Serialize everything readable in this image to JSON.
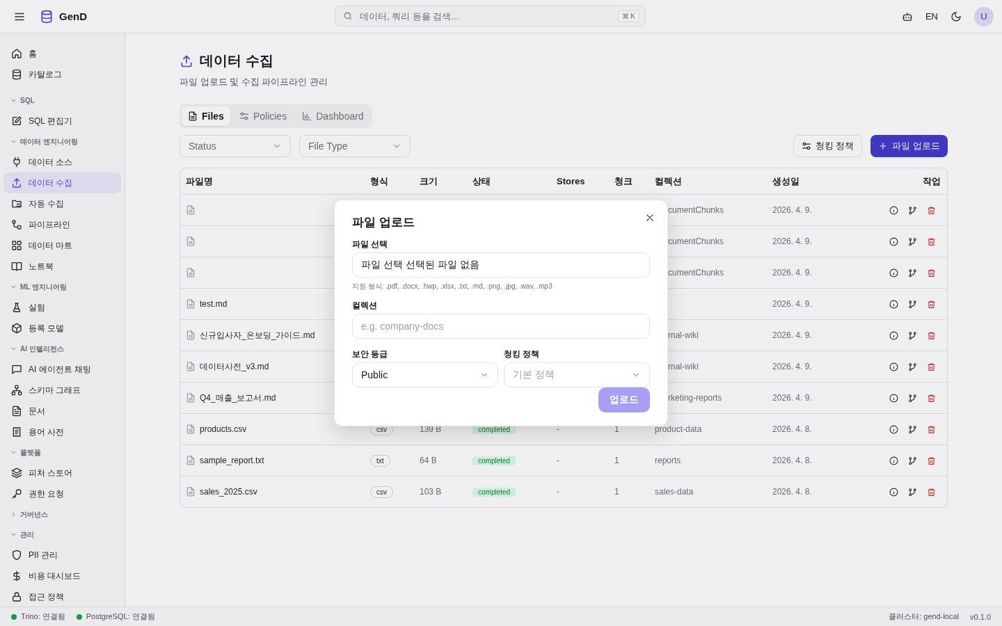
{
  "topbar": {
    "brand": "GenD",
    "search_placeholder": "데이터, 쿼리 등을 검색...",
    "shortcut": "⌘ K",
    "language": "EN",
    "avatar": "U"
  },
  "sidebar": {
    "sections": [
      {
        "items": [
          {
            "label": "홈",
            "kind": "home",
            "selected": false
          },
          {
            "label": "카탈로그",
            "kind": "database",
            "selected": false
          }
        ]
      },
      {
        "title": "SQL",
        "expanded": true,
        "items": [
          {
            "label": "SQL 편집기",
            "kind": "pencil",
            "selected": false
          }
        ]
      },
      {
        "title": "데이터 엔지니어링",
        "expanded": true,
        "items": [
          {
            "label": "데이터 소스",
            "kind": "plug",
            "selected": false
          },
          {
            "label": "데이터 수집",
            "kind": "upload",
            "selected": true
          },
          {
            "label": "자동 수집",
            "kind": "folder",
            "selected": false
          },
          {
            "label": "파이프라인",
            "kind": "nodes",
            "selected": false
          },
          {
            "label": "데이터 마트",
            "kind": "grid",
            "selected": false
          },
          {
            "label": "노트북",
            "kind": "book",
            "selected": false
          }
        ]
      },
      {
        "title": "ML 엔지니어링",
        "expanded": true,
        "items": [
          {
            "label": "실험",
            "kind": "flask",
            "selected": false
          },
          {
            "label": "등록 모델",
            "kind": "cube",
            "selected": false
          }
        ]
      },
      {
        "title": "AI 인텔리전스",
        "expanded": true,
        "items": [
          {
            "label": "AI 에이전트 채팅",
            "kind": "chat",
            "selected": false
          },
          {
            "label": "스키마 그래프",
            "kind": "hierarchy",
            "selected": false
          },
          {
            "label": "문서",
            "kind": "document",
            "selected": false
          },
          {
            "label": "용어 사전",
            "kind": "notebook",
            "selected": false
          }
        ]
      },
      {
        "title": "플랫폼",
        "expanded": true,
        "items": [
          {
            "label": "피처 스토어",
            "kind": "layers",
            "selected": false
          },
          {
            "label": "권한 요청",
            "kind": "key",
            "selected": false
          }
        ]
      },
      {
        "title": "거버넌스",
        "expanded": false
      },
      {
        "title": "관리",
        "expanded": true,
        "items": [
          {
            "label": "PII 관리",
            "kind": "shield",
            "selected": false
          },
          {
            "label": "비용 대시보드",
            "kind": "dollar",
            "selected": false
          },
          {
            "label": "접근 정책",
            "kind": "lock",
            "selected": false
          }
        ]
      }
    ]
  },
  "page": {
    "title": "데이터 수집",
    "subtitle": "파일 업로드 및 수집 파이프라인 관리",
    "tabs": [
      {
        "label": "Files",
        "kind": "file",
        "selected": true
      },
      {
        "label": "Policies",
        "kind": "sliders",
        "selected": false
      },
      {
        "label": "Dashboard",
        "kind": "chart",
        "selected": false
      }
    ],
    "filters": [
      {
        "placeholder": "Status"
      },
      {
        "placeholder": "File Type"
      }
    ],
    "buttons": [
      {
        "label": "청킹 정책",
        "kind": "secondary"
      },
      {
        "label": "파일 업로드",
        "kind": "primary"
      }
    ]
  },
  "table": {
    "columns": [
      "파일명",
      "형식",
      "크기",
      "상태",
      "Stores",
      "청크",
      "컬렉션",
      "생성일",
      "작업"
    ],
    "rows": [
      {
        "collection": "cumentChunks",
        "clipped": true,
        "created": "2026. 4. 9."
      },
      {
        "collection": "cumentChunks",
        "clipped": true,
        "created": "2026. 4. 9."
      },
      {
        "collection": "cumentChunks",
        "clipped": true,
        "created": "2026. 4. 9."
      },
      {
        "name": "test.md",
        "created": "2026. 4. 9."
      },
      {
        "name": "신규입사자_온보딩_가이드.md",
        "collection": "rnal-wiki",
        "clipped": true,
        "created": "2026. 4. 9."
      },
      {
        "name": "데이터사전_v3.md",
        "collection": "rnal-wiki",
        "clipped": true,
        "created": "2026. 4. 9."
      },
      {
        "name": "Q4_매출_보고서.md",
        "collection": "rketing-reports",
        "clipped": true,
        "created": "2026. 4. 9."
      },
      {
        "name": "products.csv",
        "format": "csv",
        "size": "139 B",
        "status": "completed",
        "stores": "-",
        "chunks": "1",
        "collection": "product-data",
        "clipped": false,
        "created": "2026. 4. 8."
      },
      {
        "name": "sample_report.txt",
        "format": "txt",
        "size": "64 B",
        "status": "completed",
        "stores": "-",
        "chunks": "1",
        "collection": "reports",
        "clipped": false,
        "created": "2026. 4. 8."
      },
      {
        "name": "sales_2025.csv",
        "format": "csv",
        "size": "103 B",
        "status": "completed",
        "stores": "-",
        "chunks": "1",
        "collection": "sales-data",
        "clipped": false,
        "created": "2026. 4. 8."
      }
    ]
  },
  "modal": {
    "title": "파일 업로드",
    "file_label": "파일 선택",
    "file_value": "파일 선택 선택된 파일 없음",
    "hint": "지원 형식: .pdf, .docx, .hwp, .xlsx, .txt, .md, .png, .jpg, .wav, .mp3",
    "collection_label": "컬렉션",
    "collection_placeholder": "e.g. company-docs",
    "security_label": "보안 등급",
    "security_value": "Public",
    "chunk_label": "청킹 정책",
    "chunk_placeholder": "기본 정책",
    "submit": "업로드",
    "submit_disabled": true
  },
  "status_bar": {
    "connections": [
      {
        "label": "Trino: 연결됨",
        "color": "#16a34a"
      },
      {
        "label": "PostgreSQL: 연결됨",
        "color": "#16a34a"
      }
    ],
    "cluster": "클러스터: gend-local",
    "version": "v0.1.0"
  }
}
